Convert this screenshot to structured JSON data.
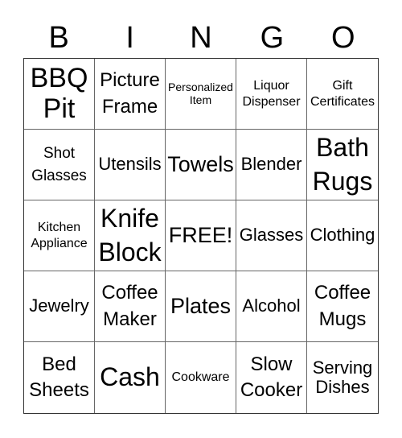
{
  "header": {
    "letters": [
      "B",
      "I",
      "N",
      "G",
      "O"
    ]
  },
  "cells": [
    [
      "BBQ Pit",
      "Picture Frame",
      "Personalized Item",
      "Liquor Dispenser",
      "Gift Certificates"
    ],
    [
      "Shot Glasses",
      "Utensils",
      "Towels",
      "Blender",
      "Bath Rugs"
    ],
    [
      "Kitchen Appliance",
      "Knife Block",
      "FREE!",
      "Glasses",
      "Clothing"
    ],
    [
      "Jewelry",
      "Coffee Maker",
      "Plates",
      "Alcohol",
      "Coffee Mugs"
    ],
    [
      "Bed Sheets",
      "Cash",
      "Cookware",
      "Slow Cooker",
      "Serving Dishes"
    ]
  ]
}
